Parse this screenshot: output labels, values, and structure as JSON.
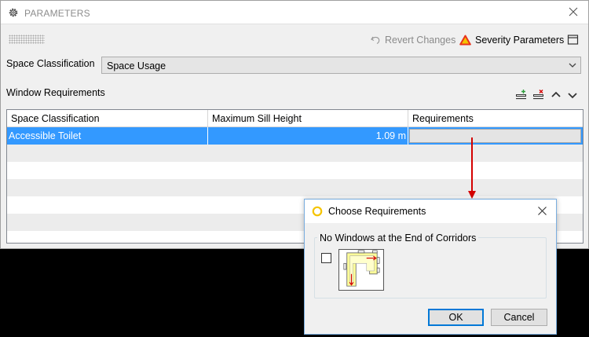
{
  "window": {
    "title": "PARAMETERS"
  },
  "toolbar": {
    "revert_label": "Revert Changes",
    "severity_label": "Severity Parameters"
  },
  "space_classification": {
    "label": "Space Classification",
    "selected": "Space Usage"
  },
  "window_requirements": {
    "label": "Window Requirements",
    "columns": [
      "Space Classification",
      "Maximum Sill Height",
      "Requirements"
    ],
    "rows": [
      {
        "space_classification": "Accessible Toilet",
        "max_sill_height": "1.09 m",
        "requirements": ""
      }
    ]
  },
  "dialog": {
    "title": "Choose Requirements",
    "group_title": "No Windows at the End of Corridors",
    "ok_label": "OK",
    "cancel_label": "Cancel"
  },
  "colors": {
    "selection": "#3399ff",
    "severity_red": "#e8331c",
    "severity_yellow": "#f5c400",
    "arrow_red": "#d40000",
    "add_green": "#2e9e3c",
    "delete_red": "#d40000"
  },
  "icons": {
    "title": "gear-icon",
    "revert": "revert-icon",
    "severity": "warning-triangle-icon",
    "panel": "panel-toggle-icon",
    "add_row": "add-row-icon",
    "delete_row": "delete-row-icon",
    "move_up": "chevron-up-icon",
    "move_down": "chevron-down-icon",
    "dialog": "circle-icon"
  }
}
